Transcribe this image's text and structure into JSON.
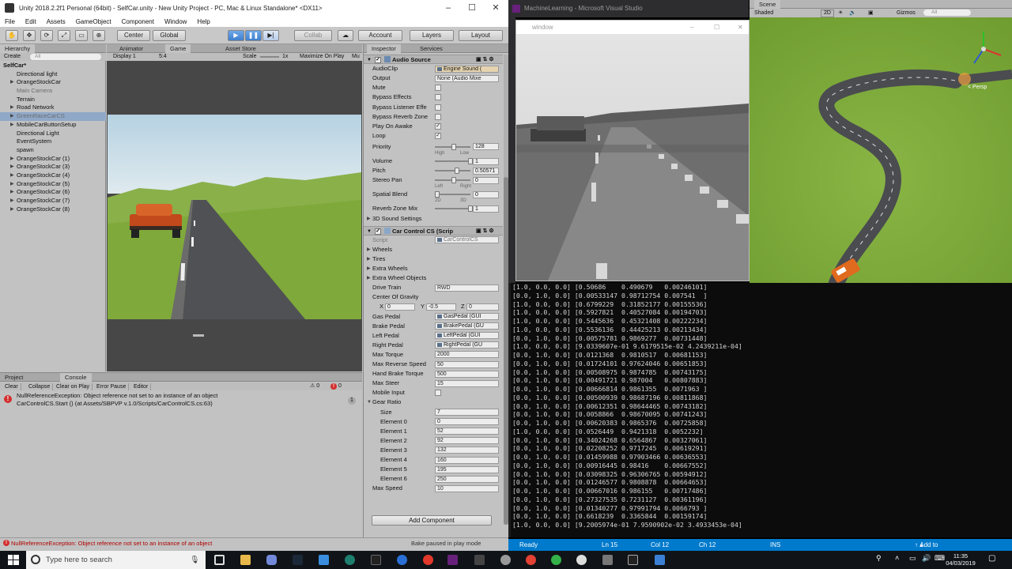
{
  "unity": {
    "title": "Unity 2018.2.2f1 Personal (64bit) - SelfCar.unity - New Unity Project - PC, Mac & Linux Standalone* <DX11>",
    "menu": [
      "File",
      "Edit",
      "Assets",
      "GameObject",
      "Component",
      "Window",
      "Help"
    ],
    "toolbar": {
      "center": "Center",
      "global": "Global",
      "collab": "Collab",
      "account": "Account",
      "layers": "Layers",
      "layout": "Layout"
    },
    "hierarchy": {
      "tab": "Hierarchy",
      "create": "Create",
      "search_placeholder": "All",
      "scene": "SelfCar*",
      "items": [
        {
          "label": "Directional light",
          "fold": false,
          "dim": false,
          "sel": false
        },
        {
          "label": "OrangeStockCar",
          "fold": true,
          "dim": false,
          "sel": false
        },
        {
          "label": "Main Camera",
          "fold": false,
          "dim": true,
          "sel": false
        },
        {
          "label": "Terrain",
          "fold": false,
          "dim": false,
          "sel": false
        },
        {
          "label": "Road Network",
          "fold": true,
          "dim": false,
          "sel": false
        },
        {
          "label": "GreenRaceCarCS",
          "fold": true,
          "dim": true,
          "sel": true
        },
        {
          "label": "MobileCarButtonSetup",
          "fold": true,
          "dim": false,
          "sel": false
        },
        {
          "label": "Directional Light",
          "fold": false,
          "dim": false,
          "sel": false
        },
        {
          "label": "EventSystem",
          "fold": false,
          "dim": false,
          "sel": false
        },
        {
          "label": "spawn",
          "fold": false,
          "dim": false,
          "sel": false
        },
        {
          "label": "OrangeStockCar (1)",
          "fold": true,
          "dim": false,
          "sel": false
        },
        {
          "label": "OrangeStockCar (3)",
          "fold": true,
          "dim": false,
          "sel": false
        },
        {
          "label": "OrangeStockCar (4)",
          "fold": true,
          "dim": false,
          "sel": false
        },
        {
          "label": "OrangeStockCar (5)",
          "fold": true,
          "dim": false,
          "sel": false
        },
        {
          "label": "OrangeStockCar (6)",
          "fold": true,
          "dim": false,
          "sel": false
        },
        {
          "label": "OrangeStockCar (7)",
          "fold": true,
          "dim": false,
          "sel": false
        },
        {
          "label": "OrangeStockCar (8)",
          "fold": true,
          "dim": false,
          "sel": false
        }
      ]
    },
    "game": {
      "tabs": [
        "Animator",
        "Game",
        "Asset Store"
      ],
      "display": "Display 1",
      "aspect": "5:4",
      "scale_label": "Scale",
      "scale_value": "1x",
      "maximize": "Maximize On Play",
      "mute": "Mu"
    },
    "console": {
      "tabs": [
        "Project",
        "Console"
      ],
      "tools": [
        "Clear",
        "Collapse",
        "Clear on Play",
        "Error Pause",
        "Editor"
      ],
      "warn_count": "0",
      "err_count": "0",
      "entry_line1": "NullReferenceException: Object reference not set to an instance of an object",
      "entry_line2": "CarControlCS.Start () (at Assets/SBPVP v.1.0/Scripts/CarControlCS.cs:63)",
      "entry_count": "1"
    },
    "inspector": {
      "tabs": [
        "Inspector",
        "Services"
      ],
      "audio_header": "Audio Source",
      "audio_rows": [
        {
          "label": "AudioClip",
          "type": "obj",
          "value": "Engine Sound (",
          "tint": true
        },
        {
          "label": "Output",
          "type": "field",
          "value": "None (Audio Mixe"
        },
        {
          "label": "Mute",
          "type": "check",
          "value": ""
        },
        {
          "label": "Bypass Effects",
          "type": "check",
          "value": ""
        },
        {
          "label": "Bypass Listener Effe",
          "type": "check",
          "value": ""
        },
        {
          "label": "Bypass Reverb Zone",
          "type": "check",
          "value": ""
        },
        {
          "label": "Play On Awake",
          "type": "check",
          "value": "✓"
        },
        {
          "label": "Loop",
          "type": "check",
          "value": "✓"
        }
      ],
      "slider_rows": [
        {
          "label": "Priority",
          "value": "128",
          "pos": 0.5,
          "sub_left": "High",
          "sub_right": "Low"
        },
        {
          "label": "Volume",
          "value": "1",
          "pos": 1.0,
          "sub_left": "",
          "sub_right": ""
        },
        {
          "label": "Pitch",
          "value": "0.50571",
          "pos": 0.6,
          "sub_left": "",
          "sub_right": ""
        },
        {
          "label": "Stereo Pan",
          "value": "0",
          "pos": 0.5,
          "sub_left": "Left",
          "sub_right": "Right"
        },
        {
          "label": "Spatial Blend",
          "value": "0",
          "pos": 0.0,
          "sub_left": "2D",
          "sub_right": "3D"
        },
        {
          "label": "Reverb Zone Mix",
          "value": "1",
          "pos": 1.0,
          "sub_left": "",
          "sub_right": ""
        }
      ],
      "sound_settings": "3D Sound Settings",
      "car_header": "Car Control CS (Scrip",
      "script_label": "Script",
      "script_value": "CarControlCS",
      "folds": [
        "Wheels",
        "Tires",
        "Extra Wheels",
        "Extra Wheel Objects"
      ],
      "drive_train_label": "Drive Train",
      "drive_train_value": "RWD",
      "cog_label": "Center Of Gravity",
      "cog": {
        "x": "0",
        "y": "-0.5",
        "z": "0"
      },
      "pedal_rows": [
        {
          "label": "Gas Pedal",
          "value": "GasPedal (GUI"
        },
        {
          "label": "Brake Pedal",
          "value": "BrakePedal (GU"
        },
        {
          "label": "Left Pedal",
          "value": "LeftPedal (GUI"
        },
        {
          "label": "Right Pedal",
          "value": "RightPedal (GU"
        }
      ],
      "num_rows": [
        {
          "label": "Max Torque",
          "value": "2000"
        },
        {
          "label": "Max Reverse Speed",
          "value": "50"
        },
        {
          "label": "Hand Brake Torque",
          "value": "500"
        },
        {
          "label": "Max Steer",
          "value": "15"
        }
      ],
      "mobile_input": "Mobile Input",
      "gear_ratio": "Gear Ratio",
      "gear_rows": [
        {
          "label": "Size",
          "value": "7"
        },
        {
          "label": "Element 0",
          "value": "0"
        },
        {
          "label": "Element 1",
          "value": "52"
        },
        {
          "label": "Element 2",
          "value": "92"
        },
        {
          "label": "Element 3",
          "value": "132"
        },
        {
          "label": "Element 4",
          "value": "160"
        },
        {
          "label": "Element 5",
          "value": "195"
        },
        {
          "label": "Element 6",
          "value": "250"
        }
      ],
      "max_speed_label": "Max Speed",
      "max_speed_value": "10",
      "add_component": "Add Component"
    },
    "status": {
      "error": "NullReferenceException: Object reference not set to an instance of an object",
      "bake": "Bake paused in play mode"
    }
  },
  "vs": {
    "title": "MachineLearning - Microsoft Visual Studio",
    "status": {
      "ready": "Ready",
      "ln": "Ln 15",
      "col": "Col 12",
      "ch": "Ch 12",
      "ins": "INS",
      "source": "Add to Source Control"
    }
  },
  "window": {
    "title": "window"
  },
  "scene": {
    "tab": "Scene",
    "shading": "Shaded",
    "mode2d": "2D",
    "gizmos": "Gizmos",
    "search": "All",
    "persp": "< Persp"
  },
  "terminal": {
    "lines": [
      "[1.0, 0.0, 0.0] [0.50686    0.490679   0.00246101]",
      "[0.0, 1.0, 0.0] [0.00533147 0.98712754 0.007541  ]",
      "[1.0, 0.0, 0.0] [0.6799229  0.31852177 0.00155536]",
      "[1.0, 0.0, 0.0] [0.5927821  0.40527084 0.00194703]",
      "[1.0, 0.0, 0.0] [0.5445636  0.45321408 0.00222234]",
      "[1.0, 0.0, 0.0] [0.5536136  0.44425213 0.00213434]",
      "[0.0, 1.0, 0.0] [0.00575781 0.9869277  0.00731448]",
      "[1.0, 0.0, 0.0] [9.0339607e-01 9.6179515e-02 4.2439211e-04]",
      "[0.0, 1.0, 0.0] [0.0121368  0.9810517  0.00681153]",
      "[0.0, 1.0, 0.0] [0.01724101 0.97624046 0.00651853]",
      "[0.0, 1.0, 0.0] [0.00508975 0.9874785  0.00743175]",
      "[0.0, 1.0, 0.0] [0.00491721 0.987004   0.00807883]",
      "[0.0, 1.0, 0.0] [0.00666814 0.9861355  0.0071963 ]",
      "[0.0, 1.0, 0.0] [0.00500939 0.98687196 0.00811868]",
      "[0.0, 1.0, 0.0] [0.00612351 0.98644465 0.00743182]",
      "[0.0, 1.0, 0.0] [0.0058866  0.98670095 0.00741243]",
      "[0.0, 1.0, 0.0] [0.00620383 0.9865376  0.00725858]",
      "[1.0, 0.0, 0.0] [0.0526449  0.9421318  0.0052232]",
      "[0.0, 1.0, 0.0] [0.34024268 0.6564867  0.00327061]",
      "[0.0, 1.0, 0.0] [0.02208252 0.9717245  0.00619291]",
      "[0.0, 1.0, 0.0] [0.01459988 0.97903466 0.00636553]",
      "[0.0, 1.0, 0.0] [0.00916445 0.98416    0.00667552]",
      "[0.0, 1.0, 0.0] [0.03098325 0.96306765 0.00594912]",
      "[0.0, 1.0, 0.0] [0.01246577 0.9808878  0.00664653]",
      "[0.0, 1.0, 0.0] [0.00667016 0.986155   0.00717486]",
      "[0.0, 1.0, 0.0] [0.27327535 0.7231127  0.00361196]",
      "[0.0, 1.0, 0.0] [0.01340277 0.97991794 0.0066793 ]",
      "[0.0, 1.0, 0.0] [0.6618239  0.3365844  0.00159174]",
      "[1.0, 0.0, 0.0] [9.2005974e-01 7.9590902e-02 3.4933453e-04]"
    ]
  },
  "taskbar": {
    "search_placeholder": "Type here to search",
    "time": "11:35",
    "date": "04/03/2019"
  },
  "colors": {
    "unity_panel": "#c2c2c2",
    "selection": "#8fa8c8",
    "vs_blue": "#007acc",
    "terminal_bg": "#0c0c0c",
    "grass": "#7fa93a"
  }
}
